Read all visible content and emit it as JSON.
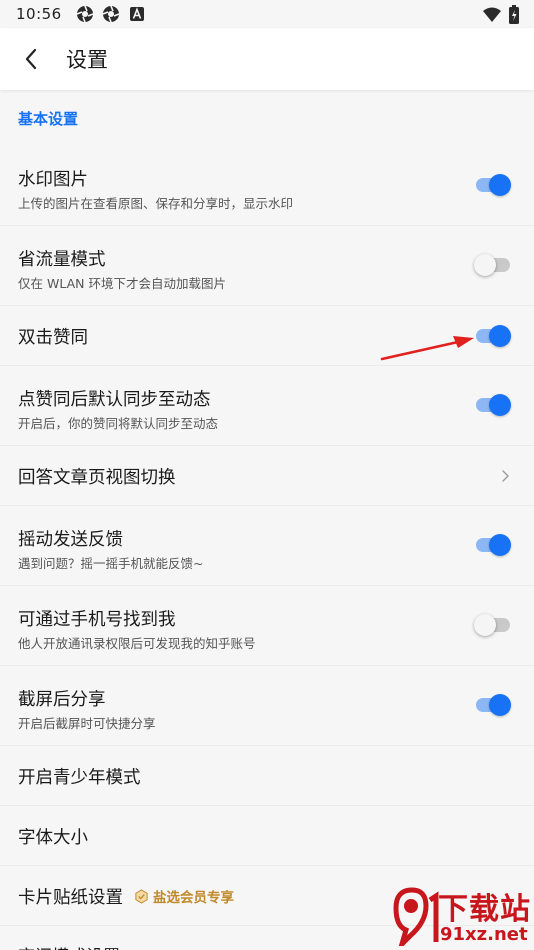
{
  "status_bar": {
    "time": "10:56",
    "icons": [
      "aperture-icon",
      "aperture-icon",
      "a-box-icon"
    ],
    "right_icons": [
      "wifi-icon",
      "battery-icon"
    ]
  },
  "app_bar": {
    "title": "设置"
  },
  "section": {
    "title": "基本设置"
  },
  "items": [
    {
      "title": "水印图片",
      "subtitle": "上传的图片在查看原图、保存和分享时，显示水印",
      "control": "toggle",
      "on": true
    },
    {
      "title": "省流量模式",
      "subtitle": "仅在 WLAN 环境下才会自动加载图片",
      "control": "toggle",
      "on": false
    },
    {
      "title": "双击赞同",
      "control": "toggle",
      "on": true
    },
    {
      "title": "点赞同后默认同步至动态",
      "subtitle": "开启后，你的赞同将默认同步至动态",
      "control": "toggle",
      "on": true
    },
    {
      "title": "回答文章页视图切换",
      "control": "chevron"
    },
    {
      "title": "摇动发送反馈",
      "subtitle": "遇到问题？摇一摇手机就能反馈~",
      "control": "toggle",
      "on": true
    },
    {
      "title": "可通过手机号找到我",
      "subtitle": "他人开放通讯录权限后可发现我的知乎账号",
      "control": "toggle",
      "on": false
    },
    {
      "title": "截屏后分享",
      "subtitle": "开启后截屏时可快捷分享",
      "control": "toggle",
      "on": true
    },
    {
      "title": "开启青少年模式",
      "control": "none"
    },
    {
      "title": "字体大小",
      "control": "none"
    },
    {
      "title": "卡片贴纸设置",
      "control": "none",
      "badge": "盐选会员专享"
    }
  ],
  "partial_item": {
    "title": "夜间模式设置"
  },
  "watermark": {
    "text_cn": "下载站",
    "text_url": "91xz.net",
    "logo": "91-logo"
  },
  "colors": {
    "accent": "#1772f6",
    "vip": "#c0892a",
    "arrow": "#e0211e",
    "watermark": "#c8161d"
  }
}
